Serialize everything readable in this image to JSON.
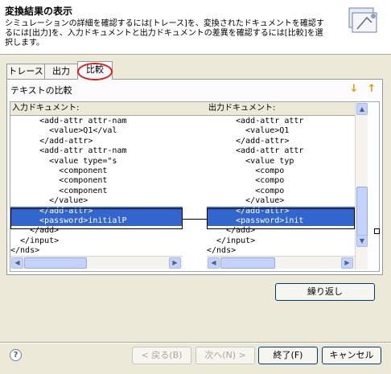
{
  "header": {
    "title": "変換結果の表示",
    "description": "シミュレーションの詳細を確認するには[トレース]を、変換されたドキュメントを確認するには[出力]を、入力ドキュメントと出力ドキュメントの差異を確認するには[比較]を選択します。"
  },
  "tabs": [
    {
      "label": "トレース"
    },
    {
      "label": "出力"
    },
    {
      "label": "比較",
      "active": true
    }
  ],
  "compare": {
    "label": "テキストの比較",
    "left": {
      "header": "入力ドキュメント:",
      "lines": [
        "      <add-attr attr-nam",
        "        <value>Q1</val",
        "      </add-attr>",
        "      <add-attr attr-nam",
        "        <value type=\"s",
        "          <component",
        "          <component",
        "          <component",
        "        </value>",
        "      </add-attr>",
        "      <password>initialP",
        "    </add>",
        "  </input>",
        "</nds>"
      ]
    },
    "right": {
      "header": "出力ドキュメント:",
      "lines": [
        "      <add-attr attr",
        "        <value>Q1",
        "      </add-attr>",
        "      <add-attr attr",
        "        <value typ",
        "          <compo",
        "          <compo",
        "          <compo",
        "        </value>",
        "      </add-attr>",
        "      <password>init",
        "    </add>",
        "  </input>",
        "</nds>"
      ]
    }
  },
  "buttons": {
    "repeat": "繰り返し",
    "back": "< 戻る(B)",
    "next": "次へ(N) >",
    "finish": "終了(F)",
    "cancel": "キャンセル",
    "help": "?"
  },
  "icons": {
    "nav_down": "↓",
    "nav_up": "↑",
    "arrow_left": "◀",
    "arrow_right": "▶",
    "arrow_up": "▲",
    "arrow_down": "▼"
  },
  "colors": {
    "selection": "#3366cc",
    "highlight_circle": "#e01a1a",
    "nav_arrows": "#e49a00"
  }
}
